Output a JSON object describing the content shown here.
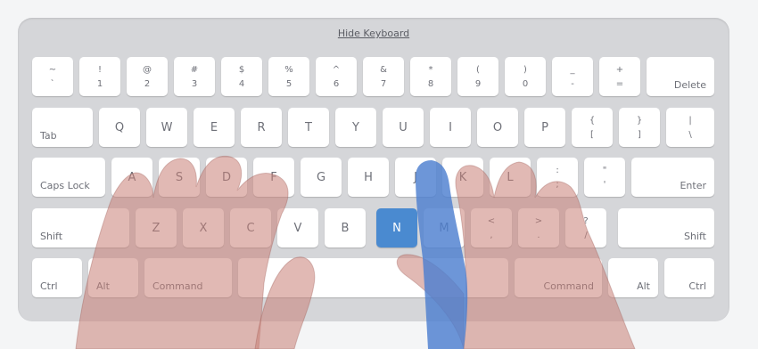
{
  "keyboard": {
    "hide_label": "Hide Keyboard",
    "active_key": "N",
    "colors": {
      "background": "#d5d6d9",
      "key": "#ffffff",
      "active_key": "#4a8ad0",
      "hand_overlay": "#c98076",
      "finger_highlight": "#4d7fd0"
    },
    "row1": [
      {
        "top": "~",
        "bot": "`"
      },
      {
        "top": "!",
        "bot": "1"
      },
      {
        "top": "@",
        "bot": "2"
      },
      {
        "top": "#",
        "bot": "3"
      },
      {
        "top": "$",
        "bot": "4"
      },
      {
        "top": "%",
        "bot": "5"
      },
      {
        "top": "^",
        "bot": "6"
      },
      {
        "top": "&",
        "bot": "7"
      },
      {
        "top": "*",
        "bot": "8"
      },
      {
        "top": "(",
        "bot": "9"
      },
      {
        "top": ")",
        "bot": "0"
      },
      {
        "top": "_",
        "bot": "-"
      },
      {
        "top": "+",
        "bot": "="
      }
    ],
    "row2_letters": [
      "Q",
      "W",
      "E",
      "R",
      "T",
      "Y",
      "U",
      "I",
      "O",
      "P"
    ],
    "row2_symbols": [
      {
        "top": "{",
        "bot": "["
      },
      {
        "top": "}",
        "bot": "]"
      },
      {
        "top": "|",
        "bot": "\\"
      }
    ],
    "row3_letters": [
      "A",
      "S",
      "D",
      "F",
      "G",
      "H",
      "J",
      "K",
      "L"
    ],
    "row3_symbols": [
      {
        "top": ":",
        "bot": ";"
      },
      {
        "top": "\"",
        "bot": "'"
      }
    ],
    "row4_letters": [
      "Z",
      "X",
      "C",
      "V",
      "B",
      "N",
      "M"
    ],
    "row4_symbols": [
      {
        "top": "<",
        "bot": ","
      },
      {
        "top": ">",
        "bot": "."
      },
      {
        "top": "?",
        "bot": "/"
      }
    ],
    "mods": {
      "delete": "Delete",
      "tab": "Tab",
      "caps": "Caps Lock",
      "enter": "Enter",
      "shift_l": "Shift",
      "shift_r": "Shift",
      "ctrl_l": "Ctrl",
      "alt_l": "Alt",
      "command_l": "Command",
      "command_r": "Command",
      "alt_r": "Alt",
      "ctrl_r": "Ctrl"
    }
  }
}
